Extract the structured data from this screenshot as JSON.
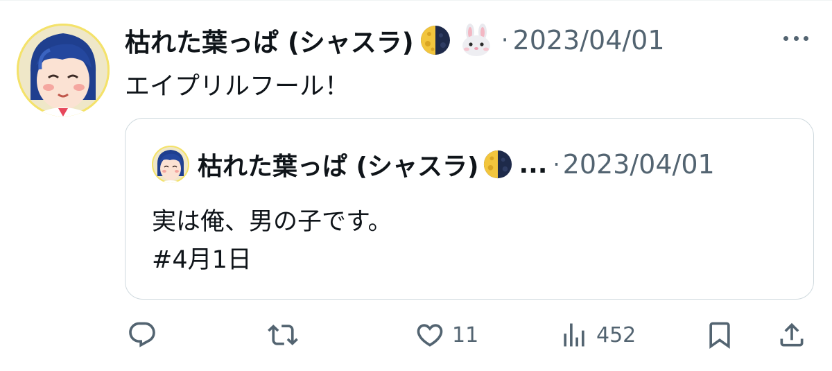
{
  "tweet": {
    "author": {
      "display_name": "枯れた葉っぱ (シャスラ)",
      "emoji_icons": [
        "moon-icon",
        "rabbit-icon"
      ]
    },
    "separator": "·",
    "date": "2023/04/01",
    "text": "エイプリルフール！",
    "more_icon": "more-horizontal-icon",
    "quoted": {
      "display_name": "枯れた葉っぱ (シャスラ)",
      "truncation": "...",
      "separator": "·",
      "date": "2023/04/01",
      "lines": [
        "実は俺、男の子です。",
        "#4月1日"
      ]
    },
    "actions": {
      "reply": {
        "icon": "reply-icon"
      },
      "retweet": {
        "icon": "retweet-icon"
      },
      "like": {
        "icon": "heart-icon",
        "count": "11"
      },
      "views": {
        "icon": "views-bar-icon",
        "count": "452"
      },
      "bookmark": {
        "icon": "bookmark-icon"
      },
      "share": {
        "icon": "share-icon"
      }
    },
    "colors": {
      "text": "#0f1419",
      "muted": "#536471",
      "border": "#cfd9de"
    }
  }
}
